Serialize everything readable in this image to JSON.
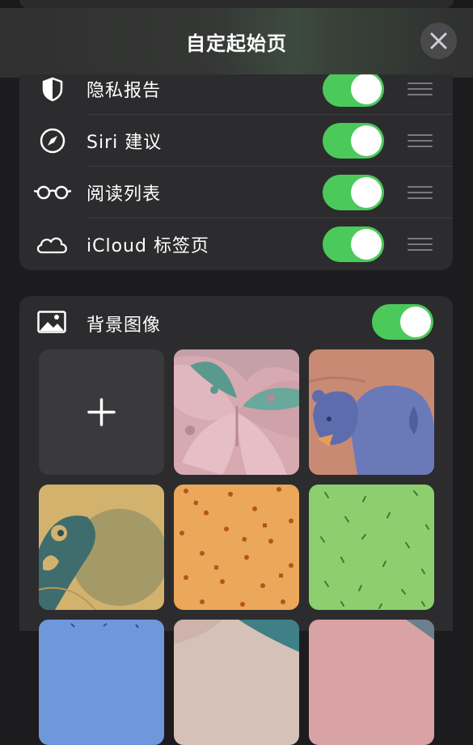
{
  "header": {
    "title": "自定起始页"
  },
  "sections": {
    "rows": [
      {
        "label": "隐私报告",
        "icon": "shield-icon",
        "enabled": true
      },
      {
        "label": "Siri 建议",
        "icon": "compass-icon",
        "enabled": true
      },
      {
        "label": "阅读列表",
        "icon": "glasses-icon",
        "enabled": true
      },
      {
        "label": "iCloud 标签页",
        "icon": "cloud-icon",
        "enabled": true
      }
    ]
  },
  "background": {
    "label": "背景图像",
    "icon": "photo-icon",
    "enabled": true,
    "tiles": [
      {
        "kind": "add",
        "icon": "plus-icon"
      },
      {
        "kind": "wallpaper",
        "name": "butterfly"
      },
      {
        "kind": "wallpaper",
        "name": "bear"
      },
      {
        "kind": "wallpaper",
        "name": "parrot"
      },
      {
        "kind": "wallpaper",
        "name": "orange-pattern"
      },
      {
        "kind": "wallpaper",
        "name": "green-pattern"
      }
    ]
  },
  "colors": {
    "toggle_on": "#4cc95b",
    "card_bg": "#2c2c2e",
    "page_bg": "#1c1c1e"
  }
}
